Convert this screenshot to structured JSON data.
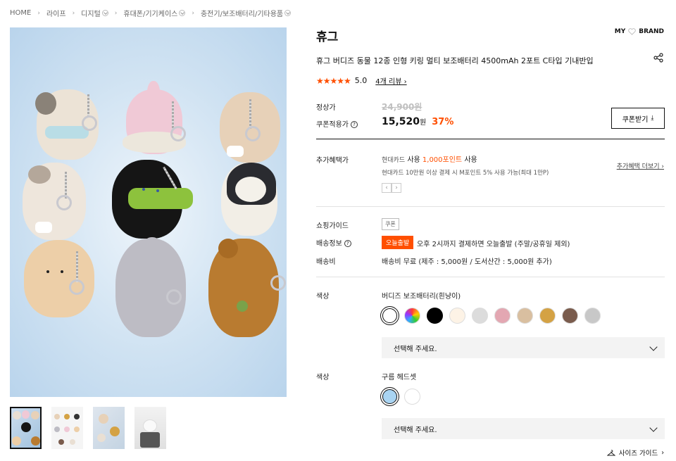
{
  "breadcrumb": [
    "HOME",
    "라이프",
    "디지털",
    "휴대폰/기기케이스",
    "충전기/보조배터리/기타용품"
  ],
  "brand": "휴그",
  "my_label": "MY",
  "brand_label": "BRAND",
  "title": "휴그 버디즈 동물 12종 인형 키링 멀티 보조배터리 4500mAh 2포트 C타입 기내반입",
  "rating": {
    "stars": "★★★★★",
    "score": "5.0",
    "review_link": "4개 리뷰"
  },
  "price": {
    "regular_label": "정상가",
    "regular_value": "24,900원",
    "coupon_label": "쿠폰적용가",
    "coupon_value": "15,520",
    "won": "원",
    "discount": "37%",
    "coupon_button": "쿠폰받기"
  },
  "benefit": {
    "label": "추가혜택가",
    "line1_prefix": "현대카드",
    "line1_mid": "사용",
    "line1_point": "1,000포인트",
    "line1_suffix": "사용",
    "line2": "현대카드 10만원 이상 결제 시 M포인트 5% 사용 가능(최대 1만P)",
    "more_link": "추가혜택 더보기"
  },
  "shopping_guide": {
    "label": "쇼핑가이드",
    "tag": "쿠폰"
  },
  "shipping": {
    "label": "배송정보",
    "badge": "오늘출발",
    "text": "오후 2시까지 결제하면 오늘출발 (주말/공휴일 제외)"
  },
  "shipping_fee": {
    "label": "배송비",
    "text": "배송비 무료 (제주 : 5,000원 / 도서산간 : 5,000원 추가)"
  },
  "option1": {
    "label": "색상",
    "selected_name": "버디즈 보조배터리(흰냥이)",
    "swatch_colors": [
      "#ffffff",
      "rainbow",
      "#000000",
      "#fdf3e6",
      "#dcdcdc",
      "#e3a7b2",
      "#d9bfa0",
      "#d4a244",
      "#7a5c4d",
      "#c8c8c8"
    ],
    "placeholder": "선택해 주세요."
  },
  "option2": {
    "label": "색상",
    "selected_name": "구름 헤드셋",
    "swatch_colors": [
      "#a9d4f2",
      "#ffffff"
    ],
    "placeholder": "선택해 주세요."
  },
  "size_guide": "사이즈 가이드"
}
